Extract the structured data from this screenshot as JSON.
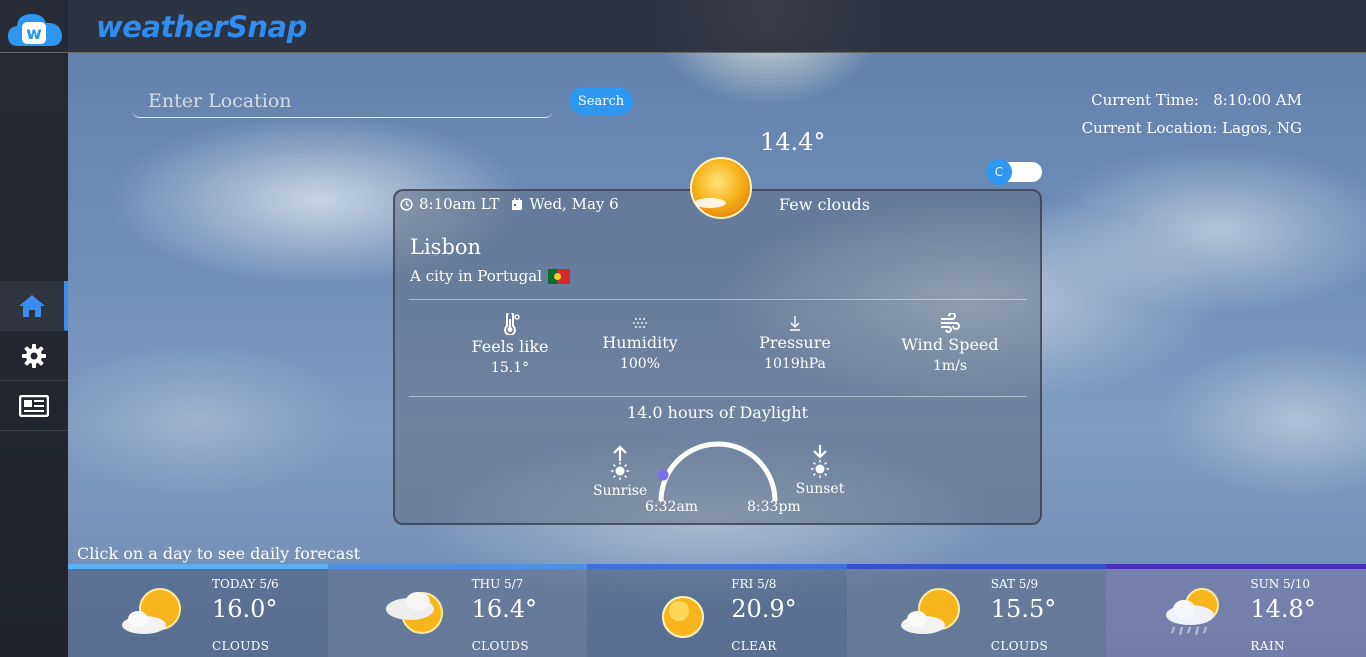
{
  "app": {
    "brand": "weatherSnap",
    "logo_letter": "w"
  },
  "sidebar": {
    "items": [
      {
        "name": "home",
        "icon": "home-icon",
        "active": true
      },
      {
        "name": "settings",
        "icon": "gear-icon",
        "active": false
      },
      {
        "name": "news",
        "icon": "newspaper-icon",
        "active": false
      }
    ]
  },
  "search": {
    "placeholder": "Enter Location",
    "value": "",
    "button_label": "Search"
  },
  "info": {
    "time_label": "Current Time:",
    "time_value": "8:10:00 AM",
    "location_label": "Current Location:",
    "location_value": "Lagos, NG"
  },
  "current": {
    "temp": "14.4°",
    "unit_toggle": "C",
    "local_time": "8:10am LT",
    "date": "Wed, May 6",
    "description": "Few clouds",
    "city": "Lisbon",
    "country_text": "A city in Portugal",
    "stats": [
      {
        "label": "Feels like",
        "value": "15.1°",
        "icon": "thermometer-icon"
      },
      {
        "label": "Humidity",
        "value": "100%",
        "icon": "humidity-icon"
      },
      {
        "label": "Pressure",
        "value": "1019hPa",
        "icon": "pressure-arrow-icon"
      },
      {
        "label": "Wind Speed",
        "value": "1m/s",
        "icon": "wind-icon"
      }
    ],
    "daylight": "14.0 hours of Daylight",
    "sunrise_label": "Sunrise",
    "sunset_label": "Sunset",
    "sunrise_time": "6:32am",
    "sunset_time": "8:33pm"
  },
  "forecast_hint": "Click on a day to see daily forecast",
  "forecast": [
    {
      "date": "TODAY 5/6",
      "temp": "16.0°",
      "condition": "CLOUDS",
      "icon": "cloudy-sun-icon",
      "bar_color": "#5ab0f0"
    },
    {
      "date": "THU 5/7",
      "temp": "16.4°",
      "condition": "CLOUDS",
      "icon": "cloudy-sun-icon",
      "bar_color": "#4f8fe6"
    },
    {
      "date": "FRI 5/8",
      "temp": "20.9°",
      "condition": "CLEAR",
      "icon": "sun-icon",
      "bar_color": "#3f6fdc"
    },
    {
      "date": "SAT 5/9",
      "temp": "15.5°",
      "condition": "CLOUDS",
      "icon": "cloudy-sun-icon",
      "bar_color": "#3550cf"
    },
    {
      "date": "SUN 5/10",
      "temp": "14.8°",
      "condition": "RAIN",
      "icon": "rain-icon",
      "bar_color": "#4a2fc2"
    }
  ]
}
